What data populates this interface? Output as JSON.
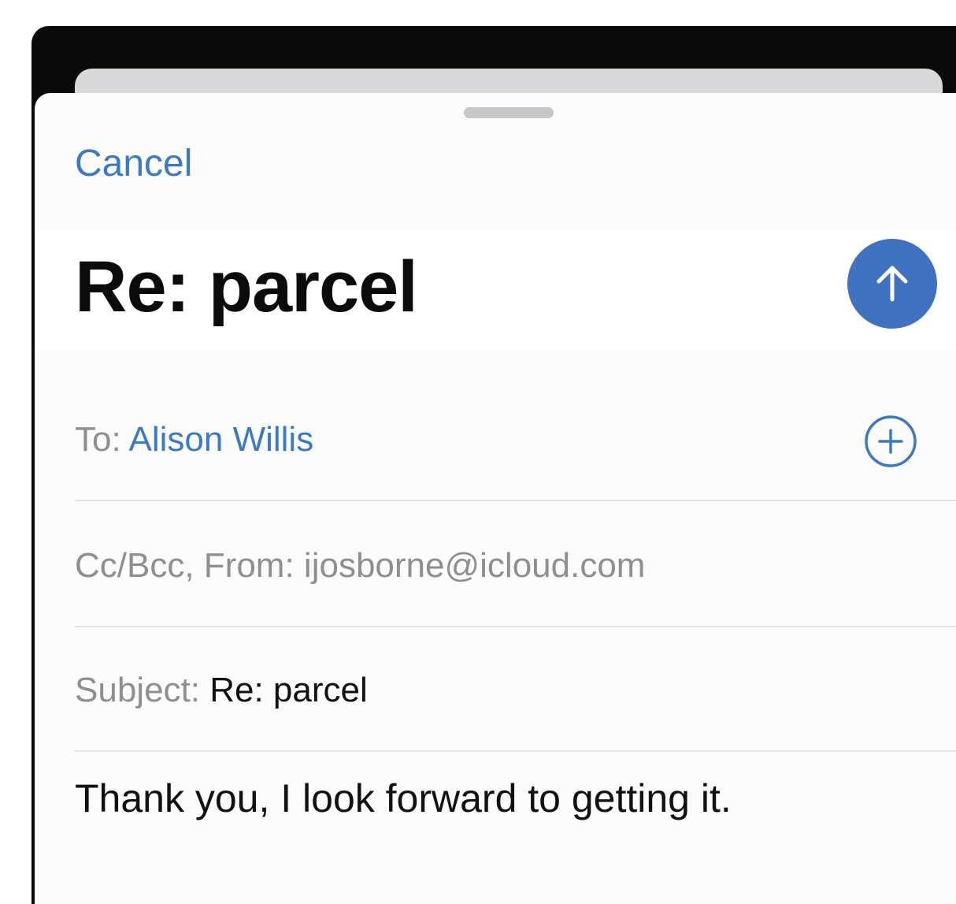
{
  "compose": {
    "cancel_label": "Cancel",
    "title": "Re: parcel",
    "to_label": "To:",
    "to_recipient": "Alison Willis",
    "from_label": "Cc/Bcc, From:",
    "from_address": "ijosborne@icloud.com",
    "subject_label": "Subject:",
    "subject_value": "Re: parcel",
    "body": "Thank you, I look forward to getting it."
  },
  "icons": {
    "send": "arrow-up-icon",
    "add_recipient": "plus-circle-icon"
  },
  "colors": {
    "accent": "#3a79c8",
    "send_button": "#3f73c2",
    "label_gray": "#8e8e93",
    "text": "#111111"
  }
}
